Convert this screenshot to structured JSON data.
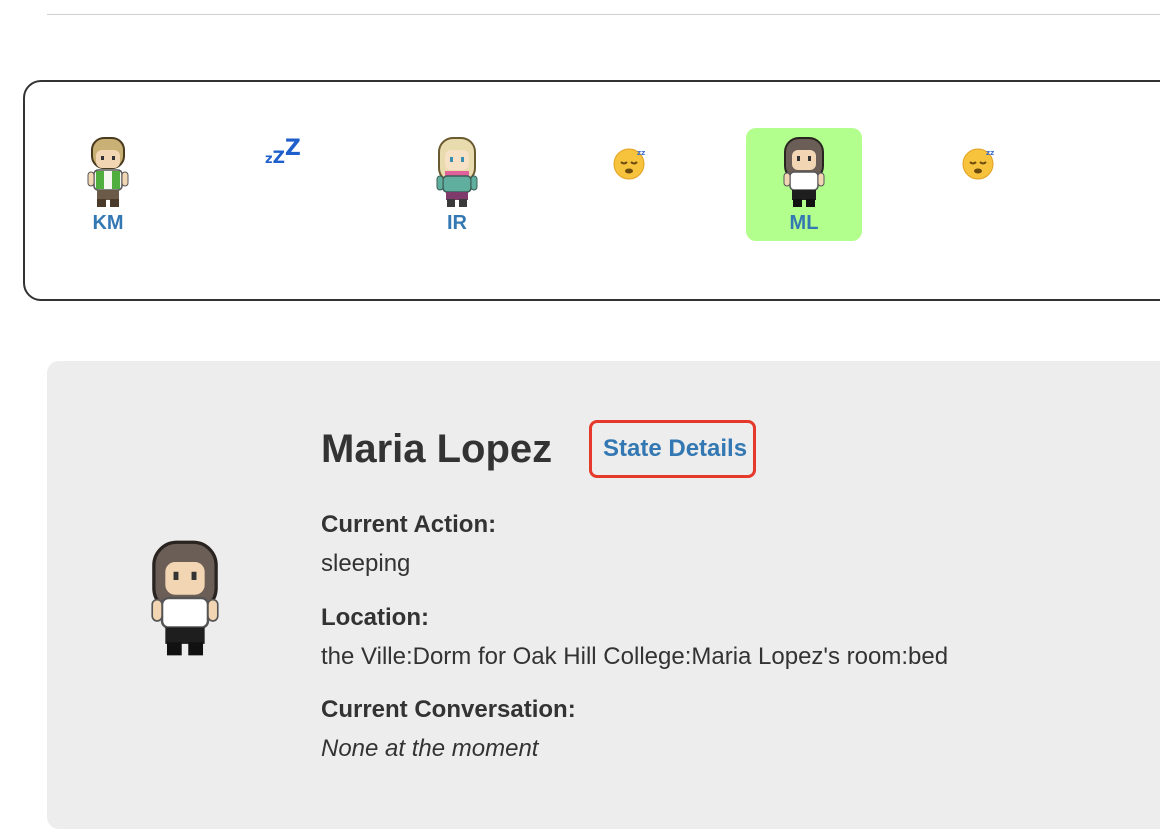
{
  "persona_bar": {
    "items": [
      {
        "type": "persona",
        "initials": "KM",
        "sprite": "blond-boy-green-vest-sprite",
        "selected": false
      },
      {
        "type": "sleep",
        "glyph": "zZZ",
        "icon": "zzz-icon"
      },
      {
        "type": "persona",
        "initials": "IR",
        "sprite": "blonde-girl-pink-scarf-sprite",
        "selected": false
      },
      {
        "type": "sleep",
        "icon": "sleeping-face-icon"
      },
      {
        "type": "persona",
        "initials": "ML",
        "sprite": "dark-hair-girl-white-shirt-sprite",
        "selected": true
      },
      {
        "type": "sleep",
        "icon": "sleeping-face-icon"
      }
    ],
    "selected_color": "#b3ff8e",
    "initials_color": "#3378b2"
  },
  "detail": {
    "name": "Maria Lopez",
    "state_details_link": "State Details",
    "fields": {
      "current_action": {
        "label": "Current Action:",
        "value": "sleeping"
      },
      "location": {
        "label": "Location:",
        "value": "the Ville:Dorm for Oak Hill College:Maria Lopez's room:bed"
      },
      "current_conversation": {
        "label": "Current Conversation:",
        "value": "None at the moment"
      }
    },
    "highlight_color": "#e5392b",
    "link_color": "#3378b2",
    "panel_color": "#ededed"
  }
}
